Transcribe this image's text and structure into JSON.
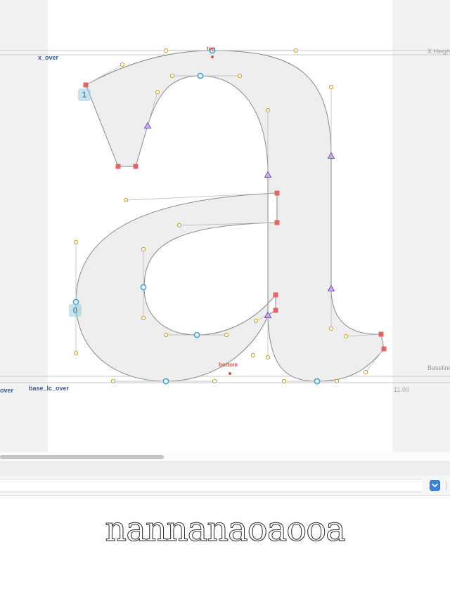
{
  "editor": {
    "glyph": "a",
    "metrics": {
      "x_over_label": "x_over",
      "top_label": "top",
      "x_height_label": "X Heigh",
      "baseline_label": "Baseline",
      "bottom_label": "bottom",
      "overshoot_label": "over",
      "base_lc_over_label": "base_lc_over",
      "width_value": "11.00"
    },
    "node_indices": [
      "1",
      "0"
    ]
  },
  "text_bar": {
    "input_value": "",
    "dropdown_icon": "chevron-down-icon"
  },
  "preview": {
    "text": "nannanaoaooa"
  },
  "colors": {
    "outline_fill": "#eeeeee",
    "outline_stroke": "#8a8a8a",
    "smooth_node": "#39a3d6",
    "corner_node": "#e06666",
    "tangent_node": "#7d4fb0",
    "handle": "#c9a227",
    "metric_label": "#3d5a93",
    "anchor_label": "#d0554e",
    "accent_button": "#3b82e0"
  }
}
